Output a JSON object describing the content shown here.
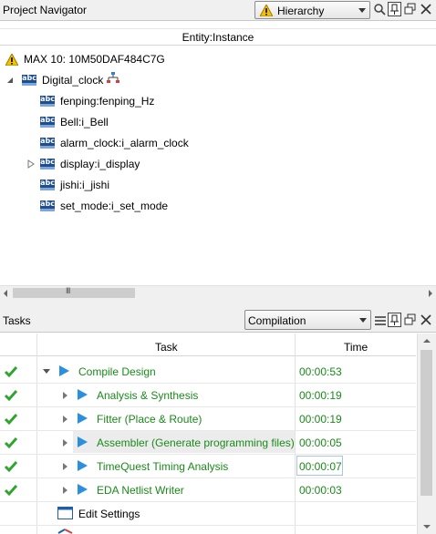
{
  "navigator": {
    "title": "Project Navigator",
    "view_select": "Hierarchy",
    "column_header": "Entity:Instance",
    "device": "MAX 10: 10M50DAF484C7G",
    "top_entity": "Digital_clock",
    "children": [
      "fenping:fenping_Hz",
      "Bell:i_Bell",
      "alarm_clock:i_alarm_clock",
      "display:i_display",
      "jishi:i_jishi",
      "set_mode:i_set_mode"
    ],
    "scroll_thumb_glyph": "III"
  },
  "tasks": {
    "title": "Tasks",
    "flow_select": "Compilation",
    "col_task": "Task",
    "col_time": "Time",
    "rows": [
      {
        "name": "Compile Design",
        "time": "00:00:53"
      },
      {
        "name": "Analysis & Synthesis",
        "time": "00:00:19"
      },
      {
        "name": "Fitter (Place & Route)",
        "time": "00:00:19"
      },
      {
        "name": "Assembler (Generate programming files)",
        "time": "00:00:05"
      },
      {
        "name": "TimeQuest Timing Analysis",
        "time": "00:00:07"
      },
      {
        "name": "EDA Netlist Writer",
        "time": "00:00:03"
      }
    ],
    "edit_settings": "Edit Settings"
  },
  "colors": {
    "accent_blue": "#2a8fe0",
    "success_green": "#1a8a1a",
    "warning_yellow": "#f2c200",
    "instance_icon": "#1f4e8c"
  },
  "icons": {
    "warning": "warning-icon",
    "instance": "abc-instance-icon",
    "check": "checkmark-icon",
    "play": "play-icon",
    "search": "search-icon",
    "pin": "pin-icon",
    "float": "float-window-icon",
    "close": "close-icon",
    "menu": "menu-icon",
    "hierarchy": "hierarchy-icon",
    "settings": "settings-window-icon"
  }
}
